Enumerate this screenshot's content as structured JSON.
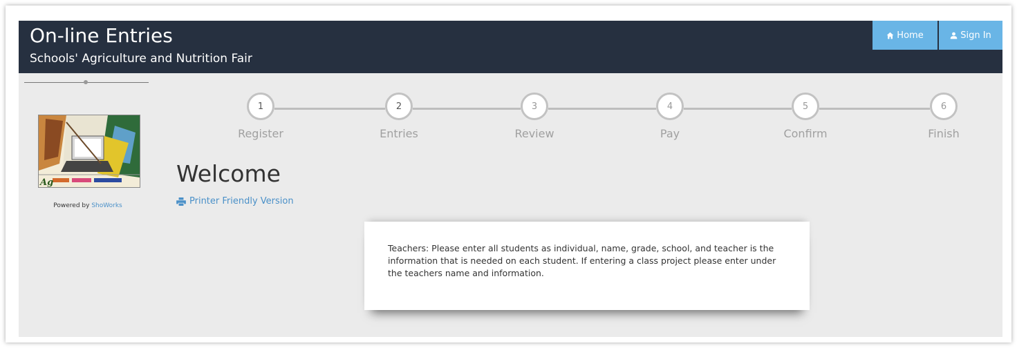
{
  "header": {
    "title": "On-line Entries",
    "subtitle": "Schools' Agriculture and Nutrition Fair"
  },
  "nav": {
    "home_label": "Home",
    "home_icon": "home-icon",
    "signin_label": "Sign In",
    "signin_icon": "user-icon"
  },
  "sidebar": {
    "powered_prefix": "Powered by",
    "powered_link": "ShoWorks",
    "logo_text": "Ag"
  },
  "steps": [
    {
      "number": "1",
      "label": "Register",
      "state": "done"
    },
    {
      "number": "2",
      "label": "Entries",
      "state": "done"
    },
    {
      "number": "3",
      "label": "Review",
      "state": "pending"
    },
    {
      "number": "4",
      "label": "Pay",
      "state": "pending"
    },
    {
      "number": "5",
      "label": "Confirm",
      "state": "pending"
    },
    {
      "number": "6",
      "label": "Finish",
      "state": "pending"
    }
  ],
  "main": {
    "welcome_title": "Welcome",
    "printer_link": "Printer Friendly Version",
    "notice": "Teachers: Please enter all students as individual, name, grade, school, and teacher is the information that is needed on each student.  If entering a class project please enter under the teachers name and information."
  },
  "colors": {
    "header_bg": "#263040",
    "nav_button": "#69b5e6",
    "link": "#4a90c8",
    "content_bg": "#ebebeb"
  }
}
